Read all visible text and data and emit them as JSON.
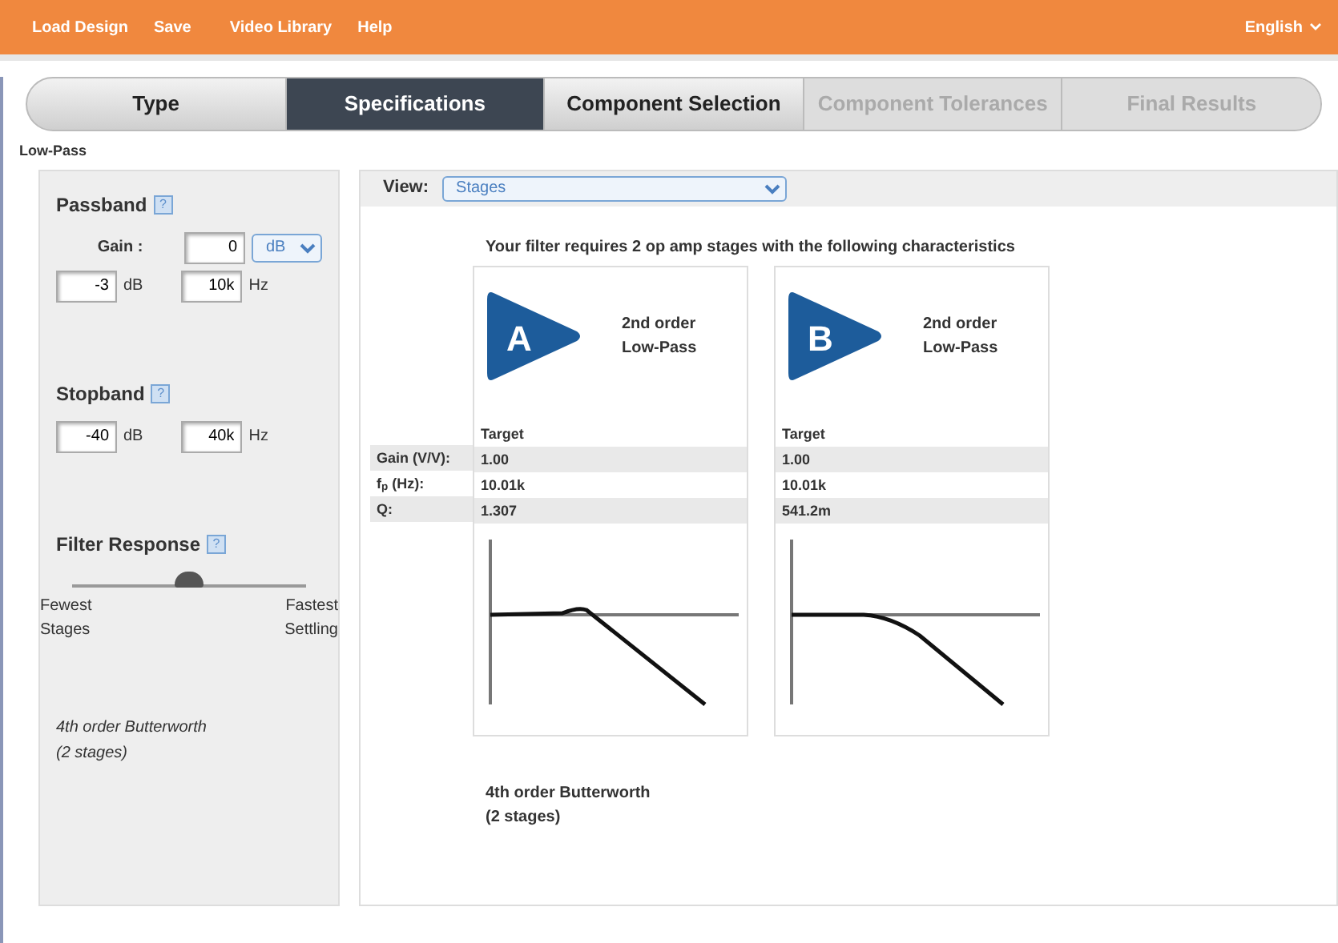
{
  "menu": {
    "items": [
      "Load Design",
      "Save",
      "Video Library",
      "Help"
    ],
    "language": "English"
  },
  "tabs": [
    {
      "label": "Type",
      "selected": false,
      "disabled": false
    },
    {
      "label": "Specifications",
      "selected": true,
      "disabled": false
    },
    {
      "label": "Component Selection",
      "selected": false,
      "disabled": false
    },
    {
      "label": "Component Tolerances",
      "selected": false,
      "disabled": true
    },
    {
      "label": "Final Results",
      "selected": false,
      "disabled": true
    }
  ],
  "filter_type": "Low-Pass",
  "sidebar": {
    "passband": {
      "title": "Passband",
      "help": "?",
      "gain_label": "Gain :",
      "gain": "0",
      "gain_unit": "dB",
      "attenuation": "-3",
      "attenuation_unit": "dB",
      "frequency": "10k",
      "frequency_unit": "Hz"
    },
    "stopband": {
      "title": "Stopband",
      "help": "?",
      "attenuation": "-40",
      "attenuation_unit": "dB",
      "frequency": "40k",
      "frequency_unit": "Hz"
    },
    "response": {
      "title": "Filter Response",
      "help": "?",
      "level": 0.5,
      "left_label": "Fewest\nStages",
      "right_label": "Fastest\nSettling"
    },
    "summary": "4th order Butterworth\n(2 stages)"
  },
  "view": {
    "label": "View:",
    "value": "Stages"
  },
  "stages": {
    "heading": "Your filter requires 2 op amp stages with the following characteristics",
    "row_labels": [
      "Gain (V/V):",
      "f$_{p}$ (Hz):",
      "Q:"
    ],
    "items": [
      {
        "letter": "A",
        "description": "2nd order\nLow-Pass",
        "column": "Target",
        "values": [
          "1.00",
          "10.01k",
          "1.307"
        ],
        "kind": "peaking"
      },
      {
        "letter": "B",
        "description": "2nd order\nLow-Pass",
        "column": "Target",
        "values": [
          "1.00",
          "10.01k",
          "541.2m"
        ],
        "kind": "rolloff"
      }
    ],
    "summary": "4th order Butterworth\n(2 stages)"
  }
}
